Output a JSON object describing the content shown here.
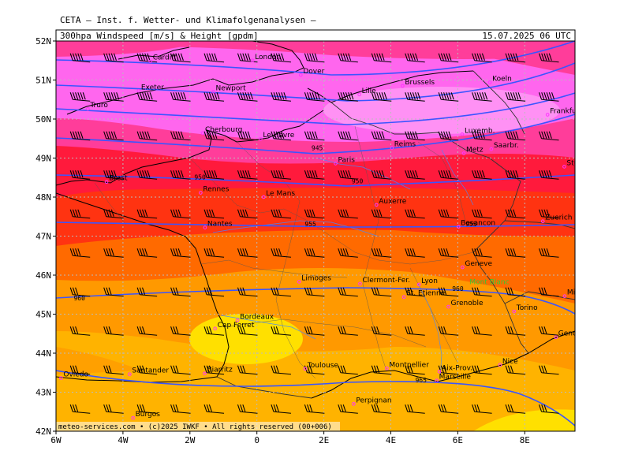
{
  "header": {
    "institute": "CETA — Inst. f. Wetter- und Klimafolgenanalysen —",
    "product": "300hpa Windspeed [m/s] & Height [gpdm]",
    "valid": "15.07.2025 06 UTC"
  },
  "footer": {
    "credit": "meteo-services.com • (c)2025 IWKF • All rights reserved (00+006)"
  },
  "axes": {
    "lon_min": -6,
    "lon_max": 9.5,
    "lat_min": 42,
    "lat_max": 52,
    "lat_labels": [
      {
        "lat": 52,
        "text": "52N"
      },
      {
        "lat": 51,
        "text": "51N"
      },
      {
        "lat": 50,
        "text": "50N"
      },
      {
        "lat": 49,
        "text": "49N"
      },
      {
        "lat": 48,
        "text": "48N"
      },
      {
        "lat": 47,
        "text": "47N"
      },
      {
        "lat": 46,
        "text": "46N"
      },
      {
        "lat": 45,
        "text": "45N"
      },
      {
        "lat": 44,
        "text": "44N"
      },
      {
        "lat": 43,
        "text": "43N"
      },
      {
        "lat": 42,
        "text": "42N"
      }
    ],
    "lon_labels": [
      {
        "lon": -6,
        "text": "6W"
      },
      {
        "lon": -4,
        "text": "4W"
      },
      {
        "lon": -2,
        "text": "2W"
      },
      {
        "lon": 0,
        "text": "0"
      },
      {
        "lon": 2,
        "text": "2E"
      },
      {
        "lon": 4,
        "text": "4E"
      },
      {
        "lon": 6,
        "text": "6E"
      },
      {
        "lon": 8,
        "text": "8E"
      }
    ],
    "grid": true
  },
  "colors": {
    "jet_core": "#ff66ee",
    "very_strong": "#ff3d9a",
    "strong": "#ff1a3c",
    "red_orange": "#ff3311",
    "orange": "#ff6a00",
    "light_orange": "#ff9900",
    "amber": "#ffb300",
    "yellow": "#ffe000",
    "contour": "#3a55ff",
    "coast": "#000000",
    "border": "#333333",
    "river": "#4488ff",
    "city_marker": "#ff33ff"
  },
  "height_labels": [
    {
      "lon": 1.8,
      "lat": 49.2,
      "text": "945"
    },
    {
      "lon": -1.7,
      "lat": 48.45,
      "text": "950"
    },
    {
      "lon": 3.0,
      "lat": 48.35,
      "text": "950"
    },
    {
      "lon": 1.6,
      "lat": 47.25,
      "text": "955"
    },
    {
      "lon": 6.4,
      "lat": 47.25,
      "text": "955"
    },
    {
      "lon": 6.0,
      "lat": 45.6,
      "text": "960"
    },
    {
      "lon": -5.3,
      "lat": 45.35,
      "text": "960"
    },
    {
      "lon": 4.9,
      "lat": 43.25,
      "text": "965"
    }
  ],
  "cities": [
    {
      "name": "Cardiff",
      "lon": -3.18,
      "lat": 51.48
    },
    {
      "name": "London",
      "lon": -0.13,
      "lat": 51.5
    },
    {
      "name": "Dover",
      "lon": 1.31,
      "lat": 51.13
    },
    {
      "name": "Exeter",
      "lon": -3.53,
      "lat": 50.72
    },
    {
      "name": "Newport",
      "lon": -1.3,
      "lat": 50.7
    },
    {
      "name": "Truro",
      "lon": -5.05,
      "lat": 50.26
    },
    {
      "name": "Lille",
      "lon": 3.06,
      "lat": 50.63
    },
    {
      "name": "Brussels",
      "lon": 4.35,
      "lat": 50.85
    },
    {
      "name": "Koeln",
      "lon": 6.96,
      "lat": 50.94
    },
    {
      "name": "Frankfurt",
      "lon": 8.68,
      "lat": 50.11
    },
    {
      "name": "Le Havre",
      "lon": 0.11,
      "lat": 49.49
    },
    {
      "name": "Reims",
      "lon": 4.03,
      "lat": 49.26
    },
    {
      "name": "Luxemb.",
      "lon": 6.13,
      "lat": 49.61
    },
    {
      "name": "Saarbr.",
      "lon": 7.0,
      "lat": 49.23
    },
    {
      "name": "Cherbourg",
      "lon": -1.62,
      "lat": 49.64
    },
    {
      "name": "Paris",
      "lon": 2.35,
      "lat": 48.86
    },
    {
      "name": "Metz",
      "lon": 6.18,
      "lat": 49.12
    },
    {
      "name": "Stuttgart",
      "lon": 9.18,
      "lat": 48.78
    },
    {
      "name": "Brest",
      "lon": -4.49,
      "lat": 48.39
    },
    {
      "name": "Rennes",
      "lon": -1.68,
      "lat": 48.11
    },
    {
      "name": "Le Mans",
      "lon": 0.2,
      "lat": 48.0
    },
    {
      "name": "Auxerre",
      "lon": 3.57,
      "lat": 47.8
    },
    {
      "name": "Nantes",
      "lon": -1.55,
      "lat": 47.22
    },
    {
      "name": "Besancon",
      "lon": 6.02,
      "lat": 47.24
    },
    {
      "name": "Zuerich",
      "lon": 8.54,
      "lat": 47.38
    },
    {
      "name": "Geneve",
      "lon": 6.14,
      "lat": 46.2
    },
    {
      "name": "Limoges",
      "lon": 1.26,
      "lat": 45.83
    },
    {
      "name": "Clermont-Fer.",
      "lon": 3.08,
      "lat": 45.78
    },
    {
      "name": "Lyon",
      "lon": 4.84,
      "lat": 45.76
    },
    {
      "name": "St. Etienne",
      "lon": 4.39,
      "lat": 45.44
    },
    {
      "name": "Grenoble",
      "lon": 5.72,
      "lat": 45.19
    },
    {
      "name": "Milano",
      "lon": 9.19,
      "lat": 45.46
    },
    {
      "name": "Torino",
      "lon": 7.68,
      "lat": 45.07
    },
    {
      "name": "Genova",
      "lon": 8.93,
      "lat": 44.41
    },
    {
      "name": "Bordeaux",
      "lon": -0.58,
      "lat": 44.84
    },
    {
      "name": "Cap Ferret",
      "lon": -1.25,
      "lat": 44.63
    },
    {
      "name": "Toulouse",
      "lon": 1.44,
      "lat": 43.6
    },
    {
      "name": "Montpellier",
      "lon": 3.88,
      "lat": 43.61
    },
    {
      "name": "Nice",
      "lon": 7.26,
      "lat": 43.7
    },
    {
      "name": "Aix-Prov.",
      "lon": 5.45,
      "lat": 43.53
    },
    {
      "name": "Marseille",
      "lon": 5.37,
      "lat": 43.3
    },
    {
      "name": "Biarritz",
      "lon": -1.56,
      "lat": 43.48
    },
    {
      "name": "Oviedo",
      "lon": -5.85,
      "lat": 43.36
    },
    {
      "name": "Santander",
      "lon": -3.8,
      "lat": 43.46
    },
    {
      "name": "Perpignan",
      "lon": 2.89,
      "lat": 42.7
    },
    {
      "name": "Burgos",
      "lon": -3.7,
      "lat": 42.34
    }
  ],
  "special_label": {
    "name": "Mont Blanc",
    "lon": 6.87,
    "lat": 45.83,
    "color": "#33cc33"
  },
  "wind_fields": {
    "note_source": "visual",
    "rows": [
      {
        "lat": 51.5,
        "speed": 50
      },
      {
        "lat": 50.5,
        "speed": 55
      },
      {
        "lat": 49.5,
        "speed": 50
      },
      {
        "lat": 48.5,
        "speed": 45
      },
      {
        "lat": 47.5,
        "speed": 40
      },
      {
        "lat": 46.5,
        "speed": 35
      },
      {
        "lat": 45.5,
        "speed": 30
      },
      {
        "lat": 44.5,
        "speed": 30
      },
      {
        "lat": 43.5,
        "speed": 30
      },
      {
        "lat": 42.5,
        "speed": 25
      }
    ]
  }
}
